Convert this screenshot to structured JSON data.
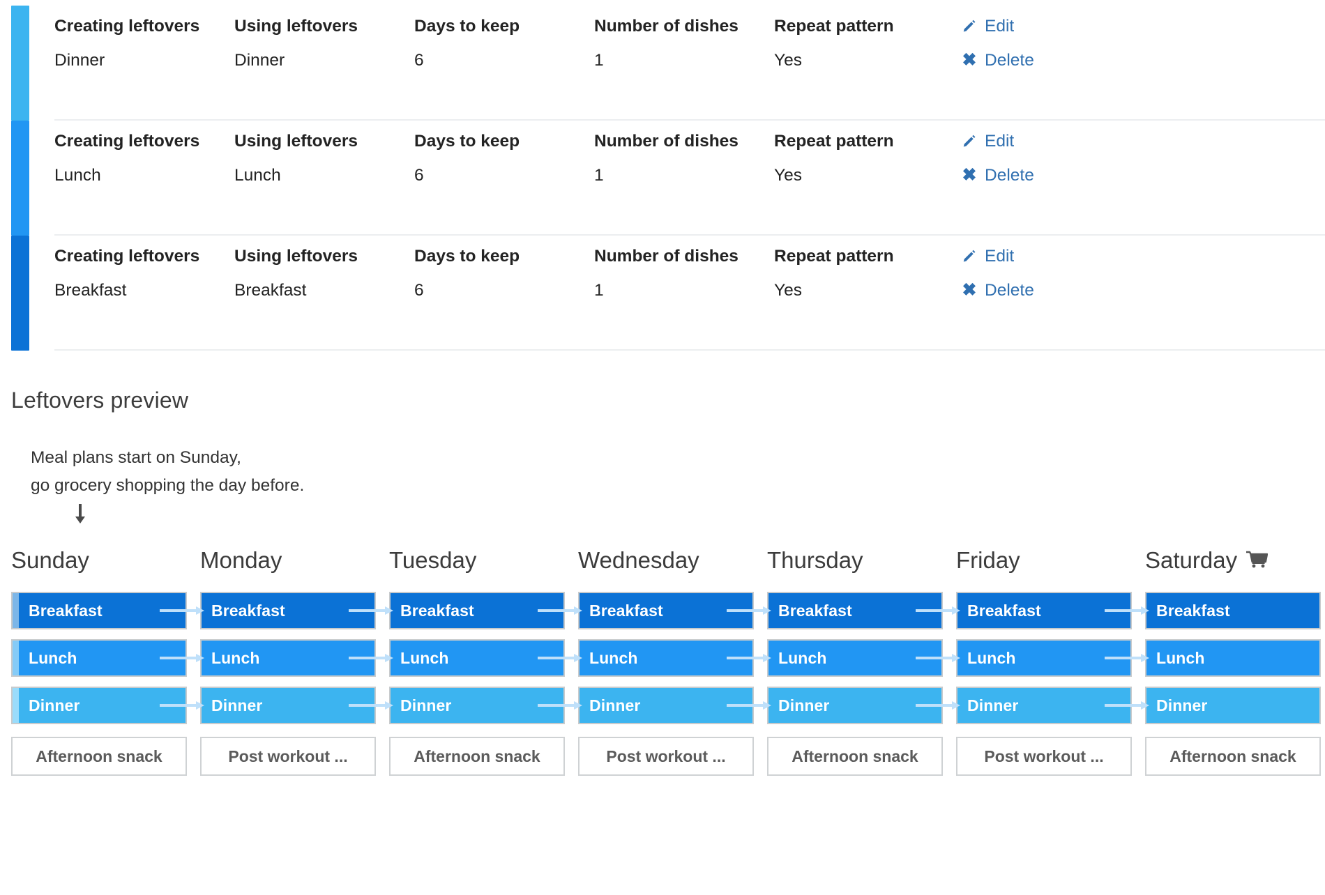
{
  "rules_table": {
    "columns": {
      "creating": "Creating leftovers",
      "using": "Using leftovers",
      "days": "Days to keep",
      "dishes": "Number of dishes",
      "repeat": "Repeat pattern"
    },
    "actions": {
      "edit_label": "Edit",
      "delete_label": "Delete",
      "edit_icon": "pencil-icon",
      "delete_icon": "cross-icon",
      "link_color": "#3170b0"
    },
    "rows": [
      {
        "creating": "Dinner",
        "using": "Dinner",
        "days": "6",
        "dishes": "1",
        "repeat": "Yes",
        "accent_color": "#3cb4f0"
      },
      {
        "creating": "Lunch",
        "using": "Lunch",
        "days": "6",
        "dishes": "1",
        "repeat": "Yes",
        "accent_color": "#2196f3"
      },
      {
        "creating": "Breakfast",
        "using": "Breakfast",
        "days": "6",
        "dishes": "1",
        "repeat": "Yes",
        "accent_color": "#0b72d6"
      }
    ]
  },
  "preview": {
    "title": "Leftovers preview",
    "note_line1": "Meal plans start on Sunday,",
    "note_line2": "go grocery shopping the day before.",
    "arrow_glyph": "⬇",
    "shopping_icon": "shopping-cart-icon",
    "days": [
      {
        "name": "Sunday",
        "cart": false
      },
      {
        "name": "Monday",
        "cart": false
      },
      {
        "name": "Tuesday",
        "cart": false
      },
      {
        "name": "Wednesday",
        "cart": false
      },
      {
        "name": "Thursday",
        "cart": false
      },
      {
        "name": "Friday",
        "cart": false
      },
      {
        "name": "Saturday",
        "cart": true
      }
    ],
    "meal_rows": [
      {
        "meal": "Breakfast",
        "color": "#0b72d6",
        "accent_color": "#7cb6e8",
        "cells": [
          "Breakfast",
          "Breakfast",
          "Breakfast",
          "Breakfast",
          "Breakfast",
          "Breakfast",
          "Breakfast"
        ]
      },
      {
        "meal": "Lunch",
        "color": "#2196f3",
        "accent_color": "#85cbf7",
        "cells": [
          "Lunch",
          "Lunch",
          "Lunch",
          "Lunch",
          "Lunch",
          "Lunch",
          "Lunch"
        ]
      },
      {
        "meal": "Dinner",
        "color": "#3cb4f0",
        "accent_color": "#9adcfb",
        "cells": [
          "Dinner",
          "Dinner",
          "Dinner",
          "Dinner",
          "Dinner",
          "Dinner",
          "Dinner"
        ]
      }
    ],
    "snack_row": [
      "Afternoon snack",
      "Post workout ...",
      "Afternoon snack",
      "Post workout ...",
      "Afternoon snack",
      "Post workout ...",
      "Afternoon snack"
    ],
    "connector_color": "#bfe0fa"
  }
}
